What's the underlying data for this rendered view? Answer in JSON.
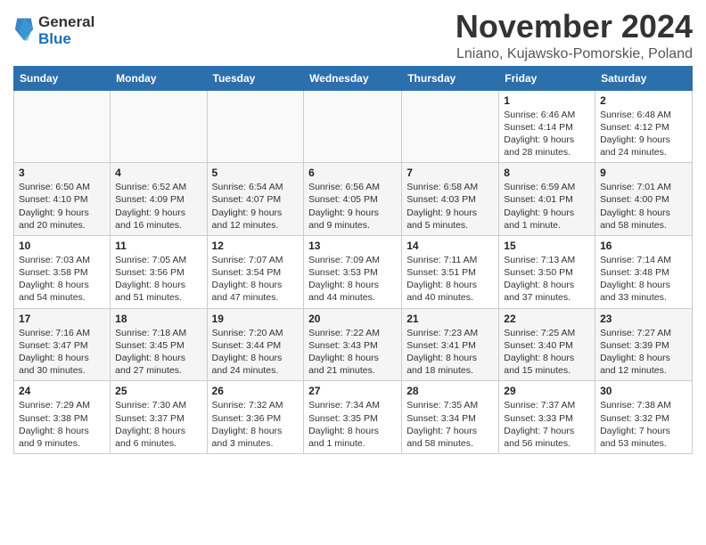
{
  "logo": {
    "general": "General",
    "blue": "Blue"
  },
  "title": "November 2024",
  "location": "Lniano, Kujawsko-Pomorskie, Poland",
  "headers": [
    "Sunday",
    "Monday",
    "Tuesday",
    "Wednesday",
    "Thursday",
    "Friday",
    "Saturday"
  ],
  "weeks": [
    [
      {
        "day": "",
        "detail": ""
      },
      {
        "day": "",
        "detail": ""
      },
      {
        "day": "",
        "detail": ""
      },
      {
        "day": "",
        "detail": ""
      },
      {
        "day": "",
        "detail": ""
      },
      {
        "day": "1",
        "detail": "Sunrise: 6:46 AM\nSunset: 4:14 PM\nDaylight: 9 hours and 28 minutes."
      },
      {
        "day": "2",
        "detail": "Sunrise: 6:48 AM\nSunset: 4:12 PM\nDaylight: 9 hours and 24 minutes."
      }
    ],
    [
      {
        "day": "3",
        "detail": "Sunrise: 6:50 AM\nSunset: 4:10 PM\nDaylight: 9 hours and 20 minutes."
      },
      {
        "day": "4",
        "detail": "Sunrise: 6:52 AM\nSunset: 4:09 PM\nDaylight: 9 hours and 16 minutes."
      },
      {
        "day": "5",
        "detail": "Sunrise: 6:54 AM\nSunset: 4:07 PM\nDaylight: 9 hours and 12 minutes."
      },
      {
        "day": "6",
        "detail": "Sunrise: 6:56 AM\nSunset: 4:05 PM\nDaylight: 9 hours and 9 minutes."
      },
      {
        "day": "7",
        "detail": "Sunrise: 6:58 AM\nSunset: 4:03 PM\nDaylight: 9 hours and 5 minutes."
      },
      {
        "day": "8",
        "detail": "Sunrise: 6:59 AM\nSunset: 4:01 PM\nDaylight: 9 hours and 1 minute."
      },
      {
        "day": "9",
        "detail": "Sunrise: 7:01 AM\nSunset: 4:00 PM\nDaylight: 8 hours and 58 minutes."
      }
    ],
    [
      {
        "day": "10",
        "detail": "Sunrise: 7:03 AM\nSunset: 3:58 PM\nDaylight: 8 hours and 54 minutes."
      },
      {
        "day": "11",
        "detail": "Sunrise: 7:05 AM\nSunset: 3:56 PM\nDaylight: 8 hours and 51 minutes."
      },
      {
        "day": "12",
        "detail": "Sunrise: 7:07 AM\nSunset: 3:54 PM\nDaylight: 8 hours and 47 minutes."
      },
      {
        "day": "13",
        "detail": "Sunrise: 7:09 AM\nSunset: 3:53 PM\nDaylight: 8 hours and 44 minutes."
      },
      {
        "day": "14",
        "detail": "Sunrise: 7:11 AM\nSunset: 3:51 PM\nDaylight: 8 hours and 40 minutes."
      },
      {
        "day": "15",
        "detail": "Sunrise: 7:13 AM\nSunset: 3:50 PM\nDaylight: 8 hours and 37 minutes."
      },
      {
        "day": "16",
        "detail": "Sunrise: 7:14 AM\nSunset: 3:48 PM\nDaylight: 8 hours and 33 minutes."
      }
    ],
    [
      {
        "day": "17",
        "detail": "Sunrise: 7:16 AM\nSunset: 3:47 PM\nDaylight: 8 hours and 30 minutes."
      },
      {
        "day": "18",
        "detail": "Sunrise: 7:18 AM\nSunset: 3:45 PM\nDaylight: 8 hours and 27 minutes."
      },
      {
        "day": "19",
        "detail": "Sunrise: 7:20 AM\nSunset: 3:44 PM\nDaylight: 8 hours and 24 minutes."
      },
      {
        "day": "20",
        "detail": "Sunrise: 7:22 AM\nSunset: 3:43 PM\nDaylight: 8 hours and 21 minutes."
      },
      {
        "day": "21",
        "detail": "Sunrise: 7:23 AM\nSunset: 3:41 PM\nDaylight: 8 hours and 18 minutes."
      },
      {
        "day": "22",
        "detail": "Sunrise: 7:25 AM\nSunset: 3:40 PM\nDaylight: 8 hours and 15 minutes."
      },
      {
        "day": "23",
        "detail": "Sunrise: 7:27 AM\nSunset: 3:39 PM\nDaylight: 8 hours and 12 minutes."
      }
    ],
    [
      {
        "day": "24",
        "detail": "Sunrise: 7:29 AM\nSunset: 3:38 PM\nDaylight: 8 hours and 9 minutes."
      },
      {
        "day": "25",
        "detail": "Sunrise: 7:30 AM\nSunset: 3:37 PM\nDaylight: 8 hours and 6 minutes."
      },
      {
        "day": "26",
        "detail": "Sunrise: 7:32 AM\nSunset: 3:36 PM\nDaylight: 8 hours and 3 minutes."
      },
      {
        "day": "27",
        "detail": "Sunrise: 7:34 AM\nSunset: 3:35 PM\nDaylight: 8 hours and 1 minute."
      },
      {
        "day": "28",
        "detail": "Sunrise: 7:35 AM\nSunset: 3:34 PM\nDaylight: 7 hours and 58 minutes."
      },
      {
        "day": "29",
        "detail": "Sunrise: 7:37 AM\nSunset: 3:33 PM\nDaylight: 7 hours and 56 minutes."
      },
      {
        "day": "30",
        "detail": "Sunrise: 7:38 AM\nSunset: 3:32 PM\nDaylight: 7 hours and 53 minutes."
      }
    ]
  ]
}
